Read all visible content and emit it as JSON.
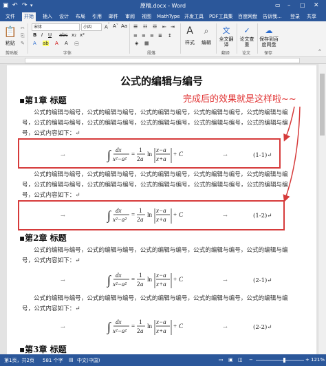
{
  "window": {
    "title": "原稿.docx - Word"
  },
  "tabs": [
    {
      "label": "文件"
    },
    {
      "label": "开始"
    },
    {
      "label": "插入"
    },
    {
      "label": "设计"
    },
    {
      "label": "布局"
    },
    {
      "label": "引用"
    },
    {
      "label": "邮件"
    },
    {
      "label": "审阅"
    },
    {
      "label": "视图"
    },
    {
      "label": "MathType"
    },
    {
      "label": "开发工具"
    },
    {
      "label": "PDF工具集"
    },
    {
      "label": "百度网盘"
    },
    {
      "label": "告诉我..."
    },
    {
      "label": "登录"
    },
    {
      "label": "共享"
    }
  ],
  "ribbon": {
    "paste": "粘贴",
    "clipboard": "剪贴板",
    "font_name": "宋体",
    "font_size": "小四",
    "font_group": "字体",
    "paragraph_group": "段落",
    "styles": "样式",
    "edit": "编辑",
    "full_translate": "全文翻译",
    "thesis_check": "论文查重",
    "save_to_baidu": "保存到百度网盘",
    "translate_group": "翻译",
    "thesis_group": "论文",
    "save_group": "保存"
  },
  "document": {
    "title": "公式的编辑与编号",
    "annotation": "完成后的效果就是这样啦~~",
    "chapter1": "第1章  标题",
    "chapter2": "第2章  标题",
    "chapter3": "第3章  标题",
    "para1": "公式的编辑与编号，公式的编辑与编号，公式的编辑与编号，公式的编辑与编号，公式的编辑与编号，公式的编辑与编号，公式的编辑与编号，公式的编辑与编号，公式的编辑与编号，公式的编辑与编号，公式内容如下：↵",
    "para2": "公式的编辑与编号，公式的编辑与编号，公式的编辑与编号，公式的编辑与编号，公式的编辑与编号，公式的编辑与编号，公式的编辑与编号，公式的编辑与编号，公式的编辑与编号，公式的编辑与编号，公式内容如下：↵",
    "para3": "公式的编辑与编号，公式的编辑与编号，公式的编辑与编号，公式的编辑与编号，公式的编辑与编号，公式内容如下：↵",
    "para4": "公式的编辑与编号，公式的编辑与编号，公式的编辑与编号，公式的编辑与编号，公式的编辑与编号，公式内容如下：↵",
    "equations": [
      {
        "number": "(1-1)↵"
      },
      {
        "number": "(1-2)↵"
      },
      {
        "number": "(2-1)↵"
      },
      {
        "number": "(2-2)↵"
      }
    ],
    "arrow": "→"
  },
  "status": {
    "page": "第1页，共2页",
    "words": "581 个字",
    "language": "中文(中国)",
    "zoom": "121%"
  },
  "colors": {
    "accent": "#2b579a",
    "highlight": "#d63a3a"
  }
}
